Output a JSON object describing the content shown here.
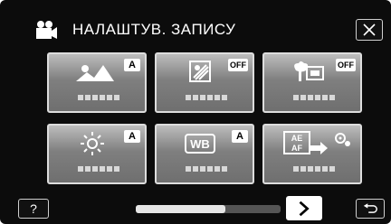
{
  "header": {
    "mode_icon": "video-camera-icon",
    "title": "НАЛАШТУВ. ЗАПИСУ",
    "close_icon": "close-icon"
  },
  "tiles": [
    {
      "icon": "scene-select-icon",
      "badge": "A",
      "dots": "■■■■■■"
    },
    {
      "icon": "backlight-compensation-icon",
      "badge": "OFF",
      "dots": "■■■■■■"
    },
    {
      "icon": "tele-macro-icon",
      "badge": "OFF",
      "dots": "■■■■■■"
    },
    {
      "icon": "brightness-icon",
      "badge": "A",
      "dots": "■■■■■■"
    },
    {
      "icon": "white-balance-icon",
      "icon_text": "WB",
      "badge": "A",
      "dots": "■■■■■■"
    },
    {
      "icon": "touch-priority-ae-af-icon",
      "icon_text": "AE AF",
      "dots": "■■■■■■"
    }
  ],
  "footer": {
    "help_label": "?",
    "scroll_position": 0.62,
    "next_icon": "chevron-right-icon",
    "back_icon": "return-icon"
  },
  "colors": {
    "background": "#0c0c0c",
    "tile_border": "#dddddd",
    "tile_top": "#bdbdbd",
    "tile_bottom": "#6f6f6f"
  }
}
